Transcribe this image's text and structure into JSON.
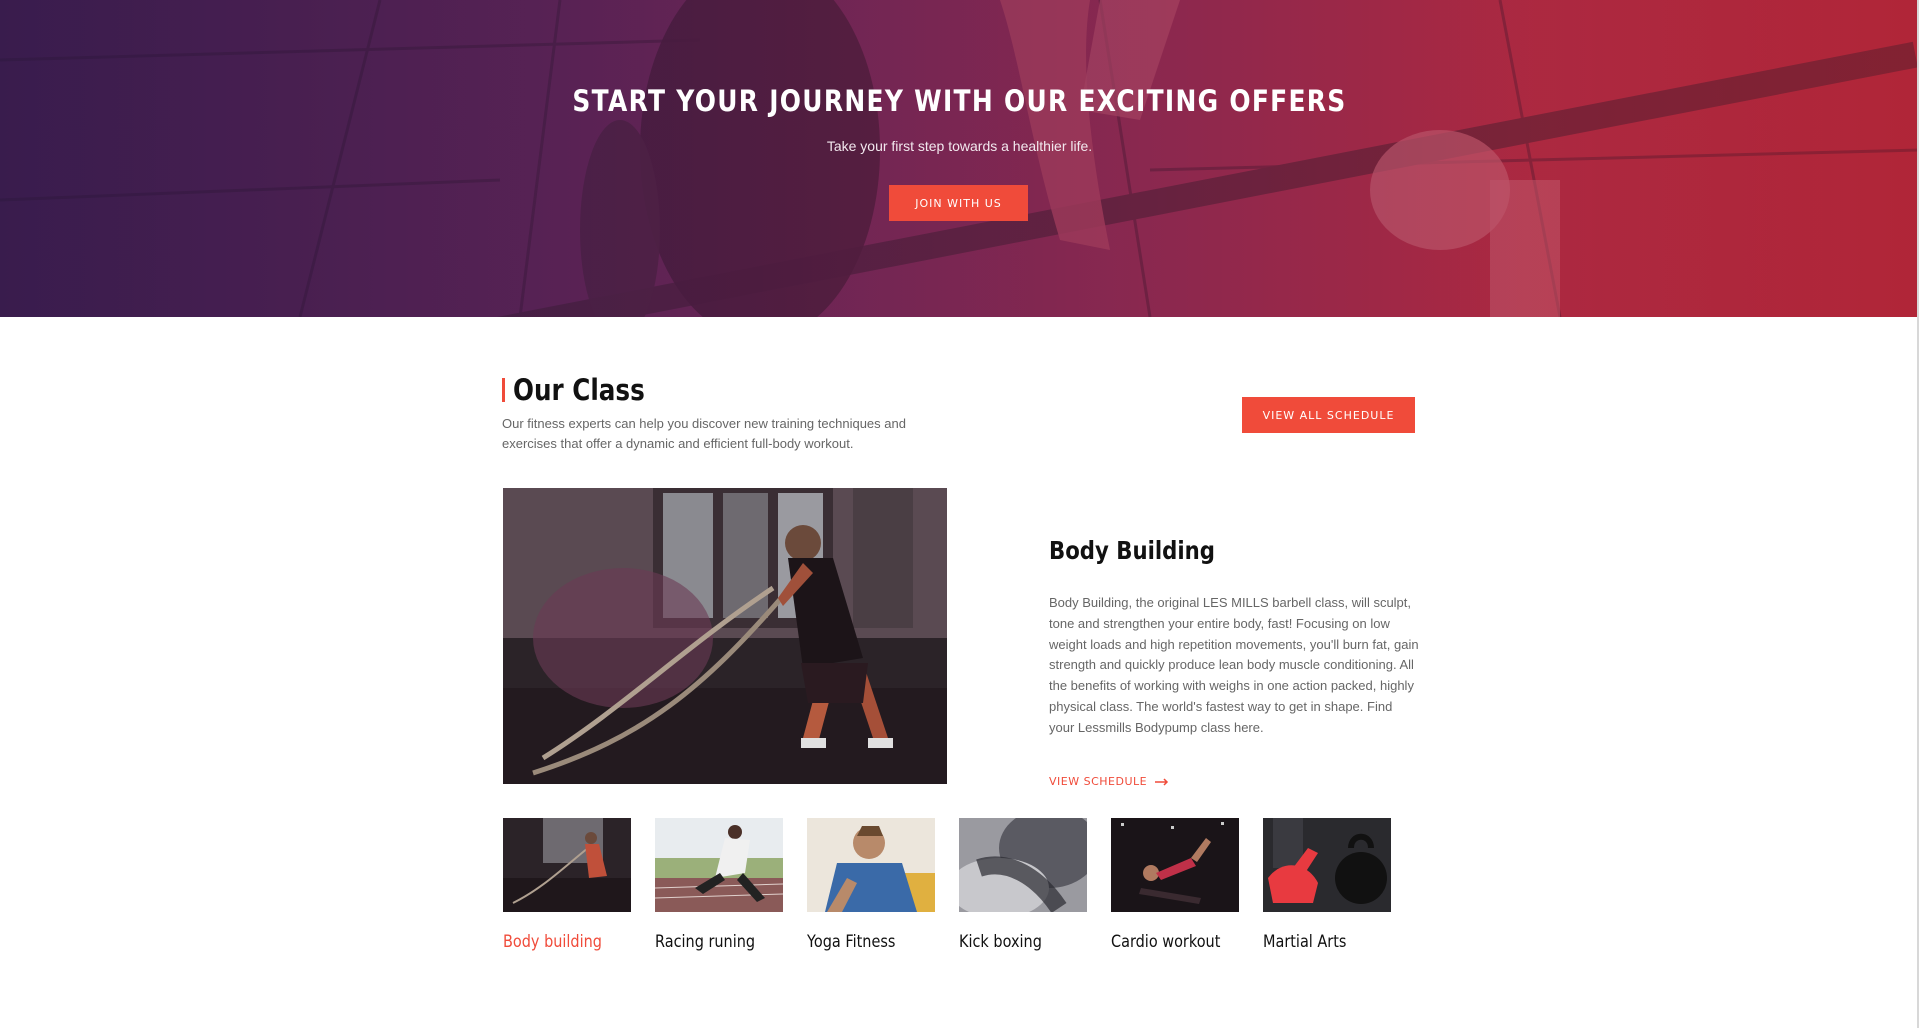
{
  "hero": {
    "title": "START YOUR JOURNEY WITH OUR EXCITING OFFERS",
    "subtitle": "Take your first step towards a healthier life.",
    "cta_label": "JOIN WITH US",
    "gradient_from": "#3b1c4c",
    "gradient_to": "#b22a3e"
  },
  "our_class": {
    "title": "Our Class",
    "description": "Our fitness experts can help you discover new training techniques and exercises that offer a dynamic and efficient full-body workout.",
    "schedule_button": "VIEW ALL SCHEDULE",
    "featured": {
      "title": "Body Building",
      "description": "Body Building, the original LES MILLS barbell class, will sculpt, tone and strengthen your entire body, fast! Focusing on low weight loads and high repetition movements, you'll burn fat, gain strength and quickly produce lean body muscle conditioning. All the benefits of working with weighs in one action packed, highly physical class. The world's fastest way to get in shape. Find your Lessmills Bodypump class here.",
      "link_label": "VIEW SCHEDULE"
    },
    "classes": [
      {
        "label": "Body building"
      },
      {
        "label": "Racing runing"
      },
      {
        "label": "Yoga Fitness"
      },
      {
        "label": "Kick boxing"
      },
      {
        "label": "Cardio workout"
      },
      {
        "label": "Martial Arts"
      }
    ],
    "accent_color": "#f04b3a"
  }
}
